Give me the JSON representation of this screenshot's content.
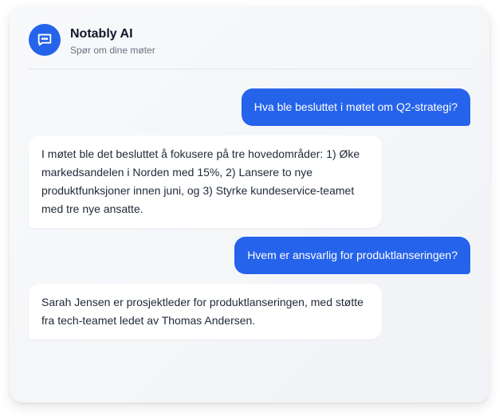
{
  "header": {
    "title": "Notably AI",
    "subtitle": "Spør om dine møter",
    "icon": "chat-bubble-icon"
  },
  "colors": {
    "accent": "#2563eb",
    "bot_bubble": "#ffffff",
    "card_bg": "#f4f5f7"
  },
  "messages": [
    {
      "role": "user",
      "text": "Hva ble besluttet i møtet om Q2-strategi?"
    },
    {
      "role": "assistant",
      "text": "I møtet ble det besluttet å fokusere på tre hovedområder: 1) Øke markedsandelen i Norden med 15%, 2) Lansere to nye produktfunksjoner innen juni, og 3) Styrke kundeservice-teamet med tre nye ansatte."
    },
    {
      "role": "user",
      "text": "Hvem er ansvarlig for produktlanseringen?"
    },
    {
      "role": "assistant",
      "text": "Sarah Jensen er prosjektleder for produktlanseringen, med støtte fra tech-teamet ledet av Thomas Andersen."
    }
  ]
}
